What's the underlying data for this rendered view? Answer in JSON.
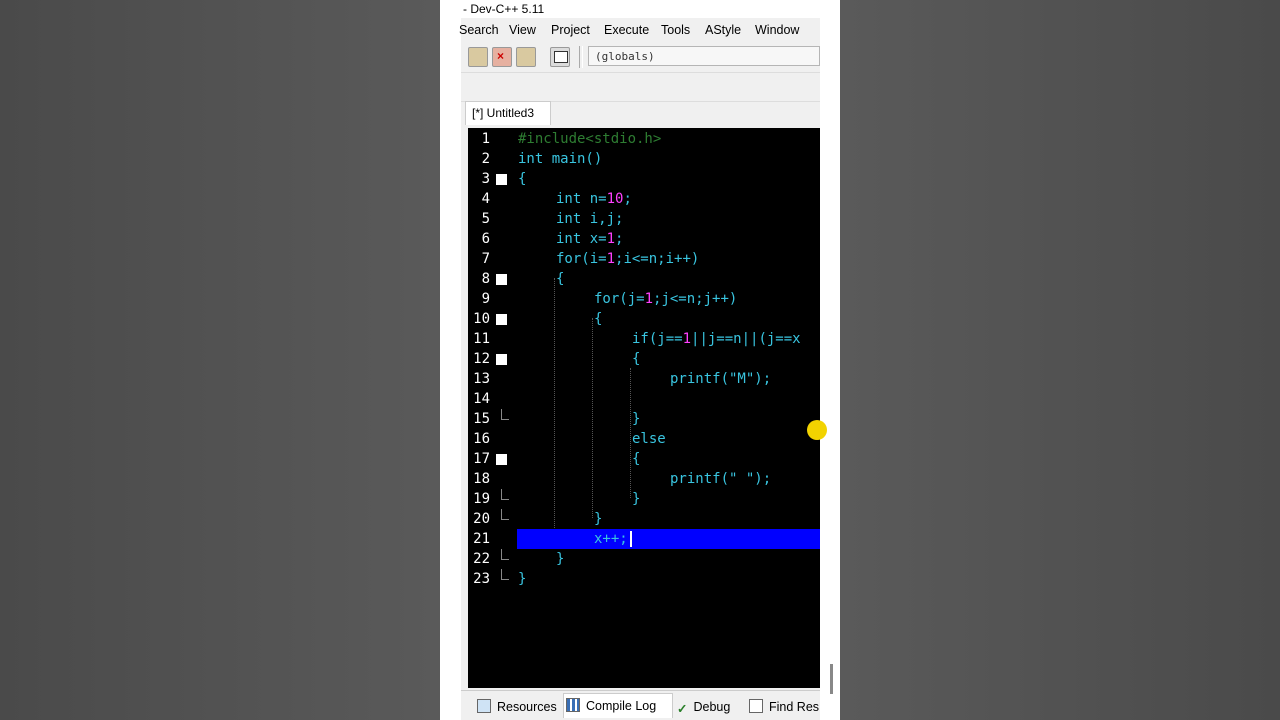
{
  "window": {
    "title": "- Dev-C++ 5.11"
  },
  "menu": [
    "Search",
    "View",
    "Project",
    "Execute",
    "Tools",
    "AStyle",
    "Window"
  ],
  "toolbar": {
    "scope_value": "(globals)"
  },
  "editor_tab": {
    "label": "[*] Untitled3"
  },
  "code_lines": [
    {
      "n": "1",
      "text": "#include<stdio.h>"
    },
    {
      "n": "2",
      "text": "int main()"
    },
    {
      "n": "3",
      "text": "{"
    },
    {
      "n": "4",
      "text": "int n=10;"
    },
    {
      "n": "5",
      "text": "int i,j;"
    },
    {
      "n": "6",
      "text": "int x=1;"
    },
    {
      "n": "7",
      "text": "for(i=1;i<=n;i++)"
    },
    {
      "n": "8",
      "text": "{"
    },
    {
      "n": "9",
      "text": "for(j=1;j<=n;j++)"
    },
    {
      "n": "10",
      "text": "{"
    },
    {
      "n": "11",
      "text": "if(j==1||j==n||(j==x"
    },
    {
      "n": "12",
      "text": "{"
    },
    {
      "n": "13",
      "text": "printf(\"M\");"
    },
    {
      "n": "14",
      "text": ""
    },
    {
      "n": "15",
      "text": "}"
    },
    {
      "n": "16",
      "text": "else"
    },
    {
      "n": "17",
      "text": "{"
    },
    {
      "n": "18",
      "text": "printf(\" \");"
    },
    {
      "n": "19",
      "text": "}"
    },
    {
      "n": "20",
      "text": "}"
    },
    {
      "n": "21",
      "text": "x++;"
    },
    {
      "n": "22",
      "text": "}"
    },
    {
      "n": "23",
      "text": "}"
    }
  ],
  "bottom_tabs": [
    "Resources",
    "Compile Log",
    "Debug",
    "Find Res"
  ],
  "colors": {
    "editor_bg": "#000000",
    "keyword": "#39c5e0",
    "number": "#ff40ff",
    "preprocessor": "#2e7d32",
    "selection": "#0000ff"
  }
}
